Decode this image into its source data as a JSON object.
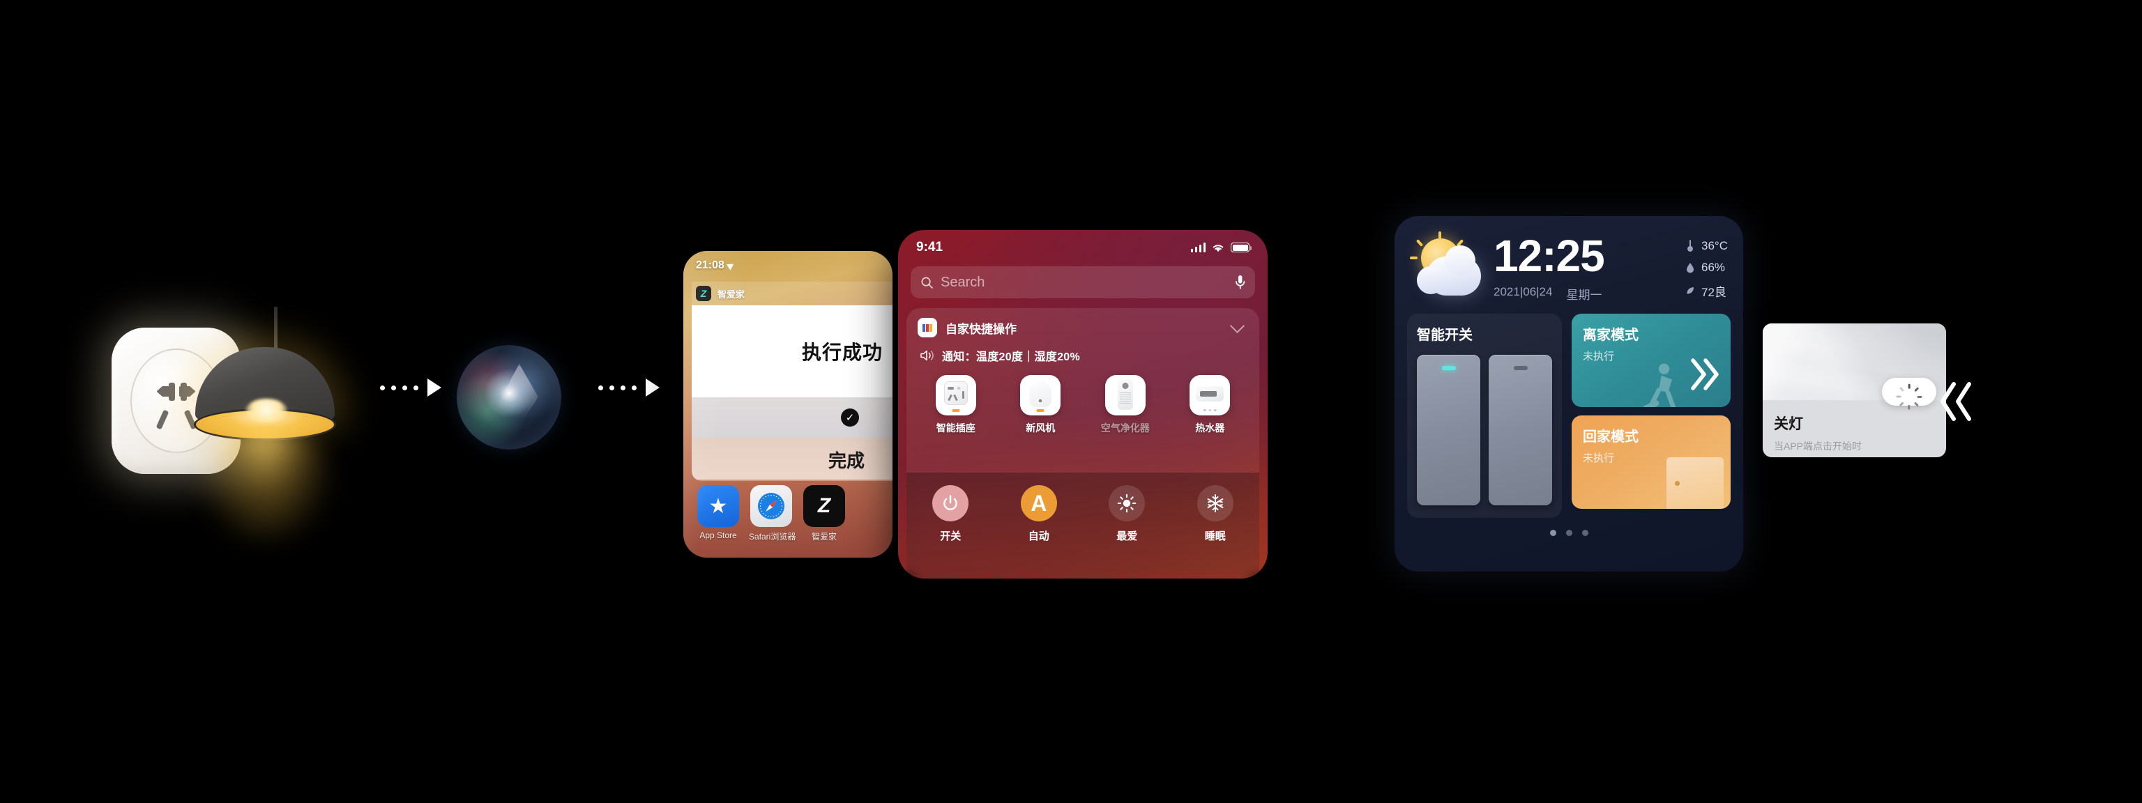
{
  "flow": {
    "arrow_1": "dots-arrow-right",
    "arrow_2": "dots-arrow-right"
  },
  "left_devices": {
    "socket_name": "smart-socket",
    "lamp_name": "pendant-lamp"
  },
  "siri": {
    "label": "siri-orb"
  },
  "phone_a": {
    "status_time": "21:08",
    "app_name": "智爱家",
    "app_icon_letter": "Z",
    "notification_title": "执行成功",
    "done_label": "完成",
    "check_glyph": "✓",
    "dock": [
      {
        "label": "App Store",
        "icon": "app-store-icon"
      },
      {
        "label": "Safari浏览器",
        "icon": "safari-icon"
      },
      {
        "label": "智爱家",
        "icon": "zhiaijia-icon"
      }
    ]
  },
  "phone_b": {
    "status_time": "9:41",
    "search_placeholder": "Search",
    "mic_icon": "microphone-icon",
    "search_icon": "search-icon",
    "card_title": "自家快捷操作",
    "card_app_icon": "ife-icon",
    "notify_text": "通知：温度20度｜湿度20%",
    "speaker_icon": "speaker-icon",
    "chevron": "chevron-down-icon",
    "devices": [
      {
        "label": "智能插座",
        "icon": "socket-icon",
        "dim": false,
        "dot": true
      },
      {
        "label": "新风机",
        "icon": "ventilator-icon",
        "dim": false,
        "dot": true
      },
      {
        "label": "空气净化器",
        "icon": "air-purifier-icon",
        "dim": true,
        "dot": false
      },
      {
        "label": "热水器",
        "icon": "water-heater-icon",
        "dim": false,
        "dot": false
      }
    ],
    "actions": [
      {
        "label": "开关",
        "icon": "power-icon"
      },
      {
        "label": "自动",
        "icon": "auto-a-icon"
      },
      {
        "label": "最爱",
        "icon": "brightness-sun-icon"
      },
      {
        "label": "睡眠",
        "icon": "snowflake-icon"
      }
    ],
    "colors": {
      "power": "#e3a1a4",
      "auto": "#eb9c35",
      "panel": "#7e1c30"
    }
  },
  "widget_panel": {
    "weather_icon": "sun-behind-cloud-icon",
    "time": "12:25",
    "date": "2021|06|24",
    "weekday": "星期一",
    "stats": [
      {
        "icon": "thermometer-icon",
        "value": "36°C"
      },
      {
        "icon": "humidity-drop-icon",
        "value": "66%"
      },
      {
        "icon": "leaf-aqi-icon",
        "value": "72良"
      }
    ],
    "switch_widget": {
      "title": "智能开关",
      "switches": [
        {
          "state": "on"
        },
        {
          "state": "off"
        }
      ]
    },
    "modes": [
      {
        "title": "离家模式",
        "status": "未执行",
        "color": "#2f8d97",
        "icon": "double-chevron-icon"
      },
      {
        "title": "回家模式",
        "status": "未执行",
        "color": "#eead63",
        "icon": "door-icon"
      }
    ],
    "page_dots": {
      "count": 3,
      "active_index": 0
    }
  },
  "light_card": {
    "title": "关灯",
    "subtitle": "当APP端点击开始时",
    "pill_icon": "loading-spinner-icon"
  },
  "chevrons": {
    "right_outer": "double-chevron-left-icon"
  }
}
